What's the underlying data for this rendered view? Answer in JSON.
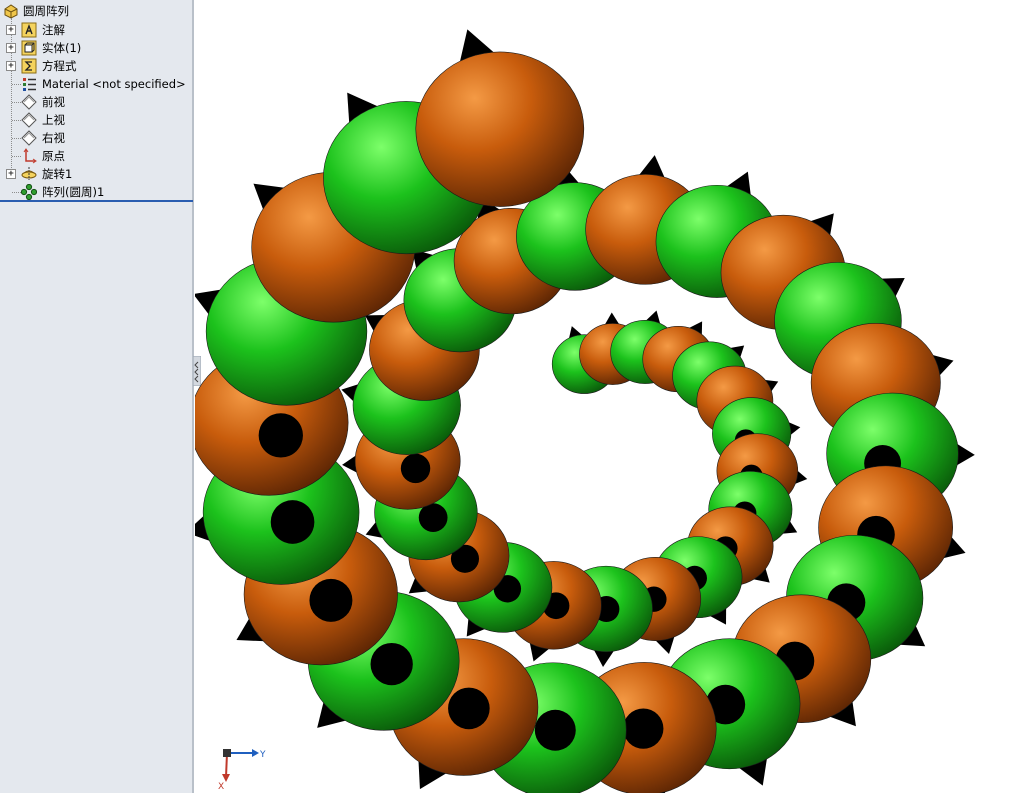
{
  "feature_tree": {
    "root": {
      "label": "圆周阵列",
      "icon": "part-icon"
    },
    "items": [
      {
        "label": "注解",
        "icon": "annotations-icon",
        "expandable": true,
        "expander": "+"
      },
      {
        "label": "实体(1)",
        "icon": "solid-bodies-icon",
        "expandable": true,
        "expander": "+"
      },
      {
        "label": "方程式",
        "icon": "equations-icon",
        "expandable": true,
        "expander": "+"
      },
      {
        "label": "Material <not specified>",
        "icon": "material-icon",
        "expandable": false
      },
      {
        "label": "前视",
        "icon": "plane-icon",
        "expandable": false
      },
      {
        "label": "上视",
        "icon": "plane-icon",
        "expandable": false
      },
      {
        "label": "右视",
        "icon": "plane-icon",
        "expandable": false
      },
      {
        "label": "原点",
        "icon": "origin-icon",
        "expandable": false
      },
      {
        "label": "旋转1",
        "icon": "revolve-feature-icon",
        "expandable": true,
        "expander": "+"
      },
      {
        "label": "阵列(圆周)1",
        "icon": "circular-pattern-icon",
        "expandable": false
      }
    ]
  },
  "viewport": {
    "model": "circular-pattern-spiral",
    "colors": {
      "green": "#1cc21c",
      "orange": "#c85c0c",
      "spike": "#000000",
      "background": "#ffffff"
    }
  },
  "triad": {
    "y_label": "Y",
    "x_label": "X"
  },
  "colors": {
    "panel_bg": "#e4e8ee",
    "rollback_bar": "#2a5db0"
  }
}
